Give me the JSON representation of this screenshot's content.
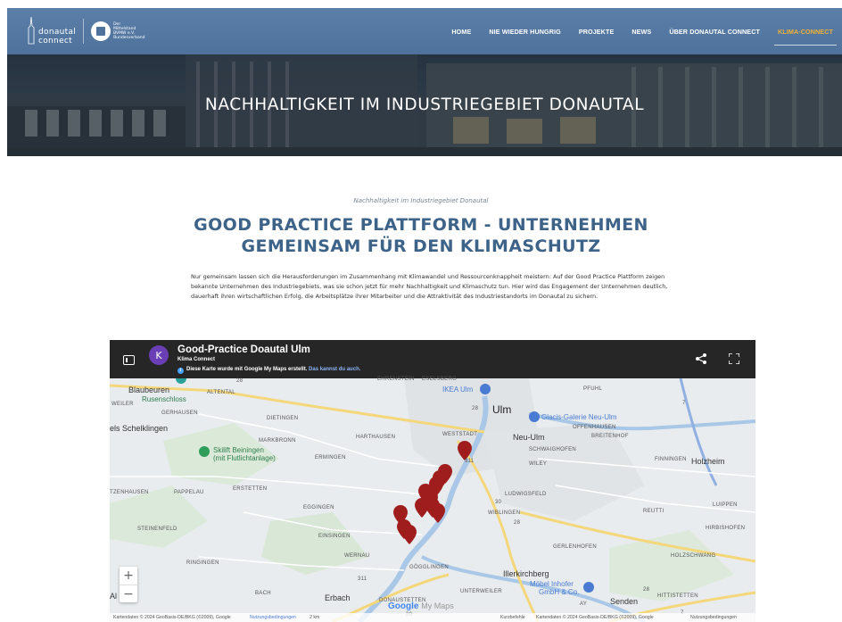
{
  "header": {
    "logo_donautal_line1": "donautal",
    "logo_donautal_line2": "connect",
    "logo_mittelstand": "Der Mittelstand BVMW e.V. Bundesverband",
    "nav": [
      {
        "label": "HOME",
        "active": false
      },
      {
        "label": "NIE WIEDER HUNGRIG",
        "active": false
      },
      {
        "label": "PROJEKTE",
        "active": false
      },
      {
        "label": "NEWS",
        "active": false
      },
      {
        "label": "ÜBER DONAUTAL CONNECT",
        "active": false
      },
      {
        "label": "KLIMA-CONNECT",
        "active": true
      }
    ],
    "active_color": "#f2b234",
    "bar_color": "#5b7fa8"
  },
  "hero": {
    "title": "NACHHALTIGKEIT IM INDUSTRIEGEBIET DONAUTAL"
  },
  "content": {
    "kicker": "Nachhaltigkeit im Industriegebiet Donautal",
    "heading": "GOOD PRACTICE PLATTFORM - UNTERNEHMEN GEMEINSAM FÜR DEN KLIMASCHUTZ",
    "intro": "Nur gemeinsam lassen sich die Herausforderungen im Zusammenhang mit Klimawandel und Ressourcenknappheit meistern: Auf der Good Practice Plattform zeigen bekannte Unternehmen des Industriegebiets, was sie schon jetzt für mehr Nachhaltigkeit und Klimaschutz tun. Hier wird das Engagement der Unternehmen deutlich, dauerhaft ihren wirtschaftlichen Erfolg, die Arbeitsplätze ihrer Mitarbeiter und die Attraktivität des Industriestandorts im Donautal zu sichern.",
    "heading_color": "#3e6389"
  },
  "map": {
    "avatar": "K",
    "title": "Good-Practice Doautal Ulm",
    "star": "☆",
    "subtitle": "Klima Connect",
    "info_text": "Diese Karte wurde mit Google My Maps erstellt.",
    "info_link": "Das kannst du auch.",
    "labels": {
      "blaubeuren": "Blaubeuren",
      "rusenschloss": "Rusenschloss",
      "altental": "ALTENTAL",
      "weiler": "WEILER",
      "gerhausen": "GERHAUSEN",
      "schelklingen": "els Schelklingen",
      "dietingen": "DIETINGEN",
      "harthausen": "HARTHAUSEN",
      "markbronn": "MARKBRONN",
      "skilift": "Skilift Beiningen",
      "skilift2": "(mit Flutlichtanlage)",
      "ermingen": "ERMINGEN",
      "ehrenstein": "EHRENSTEIN",
      "eselsberg": "ESELSBERG",
      "ikea": "IKEA Ulm",
      "ulm": "Ulm",
      "pfuhl": "PFUHL",
      "glacis": "Glacis-Galerie Neu-Ulm",
      "offenhausen": "OFFENHAUSEN",
      "weststadt": "WESTSTADT",
      "neuulm": "Neu-Ulm",
      "breitenhof": "BREITENHOF",
      "schwaighofen": "SCHWAIGHOFEN",
      "wiley": "WILEY",
      "finningen": "FINNINGEN",
      "holzheim": "Holzheim",
      "zenhausen": "TZENHAUSEN",
      "pappelau": "PAPPELAU",
      "erstetten": "ERSTETTEN",
      "eggingen": "EGGINGEN",
      "ludwigsfeld": "LUDWIGSFELD",
      "wiblingen": "WIBLINGEN",
      "reutti": "REUTTI",
      "luippen": "LUIPPEN",
      "steinenfeld": "STEINENFELD",
      "einsingen": "EINSINGEN",
      "hirbishofen": "HIRBISHOFEN",
      "gerlenhofen": "GERLENHOFEN",
      "wernau": "WERNAU",
      "holzschwang": "HOLZSCHWANG",
      "ringingen": "RINGINGEN",
      "gogglingen": "GÖGGLINGEN",
      "illerkirchberg": "Illerkirchberg",
      "mobel": "Möbel Inhofer",
      "mobel2": "GmbH & Co.",
      "bach": "BACH",
      "erbach": "Erbach",
      "donaustetten": "DONAUSTETTEN",
      "unterweiler": "UNTERWEILER",
      "senden": "Senden",
      "hittistetten": "HITTISTETTEN",
      "ay": "AY",
      "al": "Al",
      "road28a": "28",
      "road28b": "28",
      "road311a": "311",
      "road311b": "311",
      "road30a": "30",
      "road30b": "30",
      "road28c": "28",
      "road28d": "28",
      "road7a": "7",
      "road7b": "7"
    },
    "google_logo": "Google",
    "my_maps": "My Maps",
    "zoom_in": "+",
    "zoom_out": "−",
    "footer_left": "Kartendaten © 2024 GeoBasis-DE/BKG (©2009), Google",
    "footer_terms": "Nutzungsbedingungen",
    "footer_scale": "2 km",
    "footer_shortcuts": "Kurzbefehle",
    "footer_right": "Kartendaten © 2024 GeoBasis-DE/BKG (©2009), Google",
    "footer_terms2": "Nutzungsbedingungen",
    "marker_color": "#a01d1d"
  }
}
